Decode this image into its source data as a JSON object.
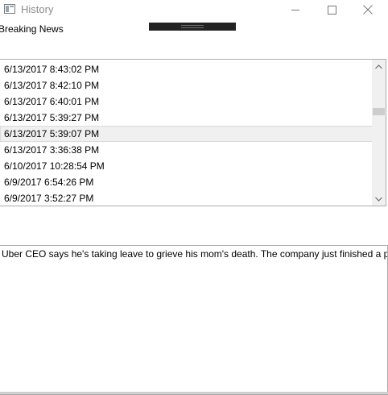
{
  "window": {
    "title": "History",
    "app_icon": "window-icon",
    "controls": [
      "minimize-icon",
      "maximize-icon",
      "close-icon"
    ]
  },
  "header": {
    "label": "Breaking News"
  },
  "history_list": {
    "items": [
      "6/13/2017 8:43:02 PM",
      "6/13/2017 8:42:10 PM",
      "6/13/2017 6:40:01 PM",
      "6/13/2017 5:39:27 PM",
      "6/13/2017 5:39:07 PM",
      "6/13/2017 3:36:38 PM",
      "6/10/2017 10:28:54 PM",
      "6/9/2017 6:54:26 PM",
      "6/9/2017 3:52:27 PM"
    ],
    "hovered_index": 4
  },
  "detail": {
    "text": "Uber CEO says he's taking leave to grieve his mom's death. The company just finished a pro"
  },
  "colors": {
    "title_text": "#8c8c8c",
    "border": "#adadad",
    "scrollbar_track": "#f0f0f0",
    "scrollbar_thumb": "#cdcdcd",
    "drag_bar": "#232323"
  }
}
